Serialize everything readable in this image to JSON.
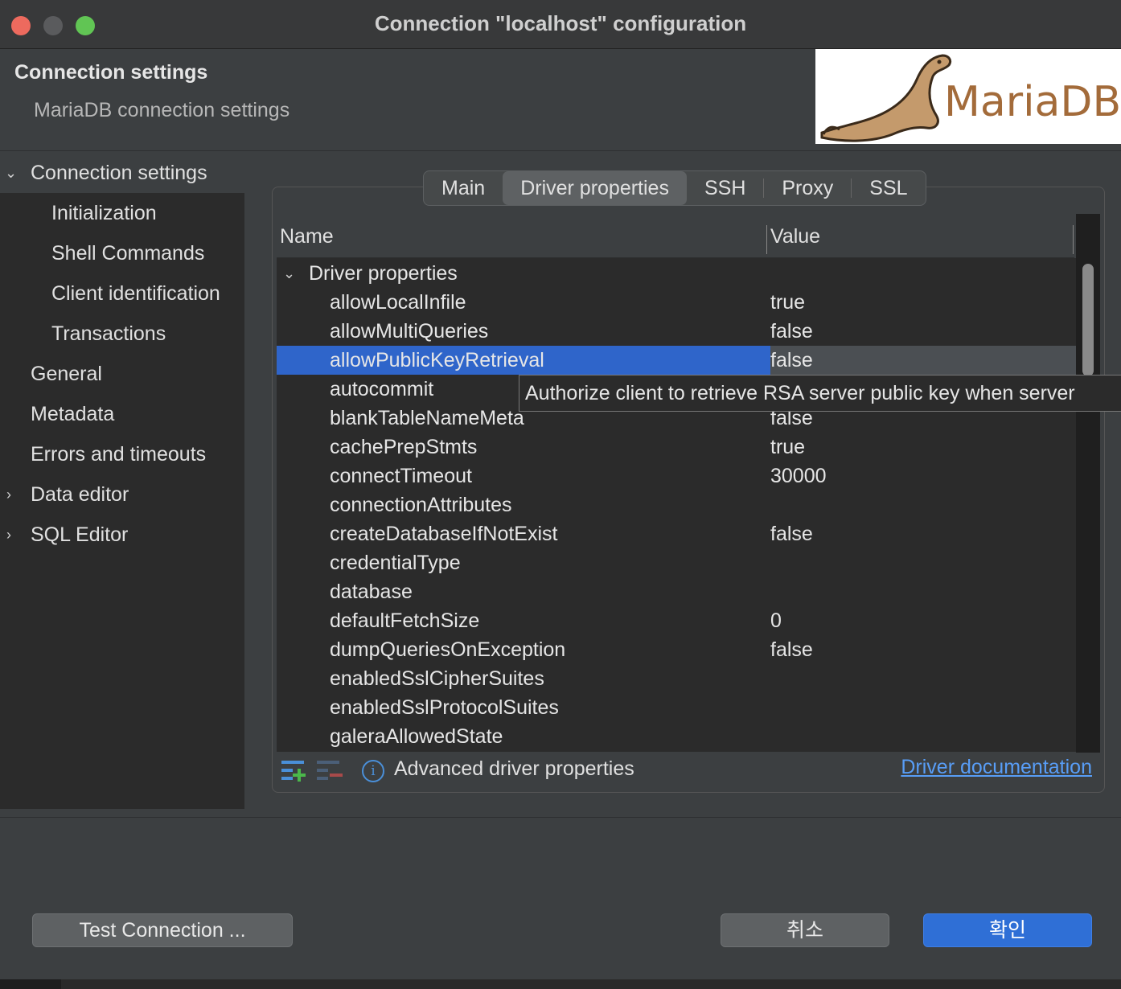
{
  "window": {
    "title": "Connection \"localhost\" configuration"
  },
  "header": {
    "title": "Connection settings",
    "subtitle": "MariaDB connection settings",
    "logo_text": "MariaDB"
  },
  "sidebar": {
    "items": [
      {
        "label": "Connection settings",
        "arrow": "chevron-down"
      },
      {
        "label": "Initialization"
      },
      {
        "label": "Shell Commands"
      },
      {
        "label": "Client identification"
      },
      {
        "label": "Transactions"
      },
      {
        "label": "General"
      },
      {
        "label": "Metadata"
      },
      {
        "label": "Errors and timeouts"
      },
      {
        "label": "Data editor",
        "arrow": "chevron-right"
      },
      {
        "label": "SQL Editor",
        "arrow": "chevron-right"
      }
    ]
  },
  "tabs": [
    {
      "label": "Main"
    },
    {
      "label": "Driver properties",
      "active": true
    },
    {
      "label": "SSH"
    },
    {
      "label": "Proxy"
    },
    {
      "label": "SSL"
    }
  ],
  "table": {
    "col_name": "Name",
    "col_value": "Value",
    "group_label": "Driver properties",
    "rows": [
      {
        "name": "allowLocalInfile",
        "value": "true"
      },
      {
        "name": "allowMultiQueries",
        "value": "false"
      },
      {
        "name": "allowPublicKeyRetrieval",
        "value": "false"
      },
      {
        "name": "autocommit",
        "value": ""
      },
      {
        "name": "blankTableNameMeta",
        "value": "false"
      },
      {
        "name": "cachePrepStmts",
        "value": "true"
      },
      {
        "name": "connectTimeout",
        "value": "30000"
      },
      {
        "name": "connectionAttributes",
        "value": ""
      },
      {
        "name": "createDatabaseIfNotExist",
        "value": "false"
      },
      {
        "name": "credentialType",
        "value": ""
      },
      {
        "name": "database",
        "value": ""
      },
      {
        "name": "defaultFetchSize",
        "value": "0"
      },
      {
        "name": "dumpQueriesOnException",
        "value": "false"
      },
      {
        "name": "enabledSslCipherSuites",
        "value": ""
      },
      {
        "name": "enabledSslProtocolSuites",
        "value": ""
      },
      {
        "name": "galeraAllowedState",
        "value": ""
      }
    ]
  },
  "tooltip": {
    "text": "Authorize client to retrieve RSA server public key when server"
  },
  "footer": {
    "advanced_label": "Advanced driver properties",
    "doc_link": "Driver documentation"
  },
  "buttons": {
    "test": "Test Connection ...",
    "cancel": "취소",
    "ok": "확인"
  },
  "colors": {
    "selection": "#2f65ca",
    "ok_button": "#2f6fd6",
    "link": "#589df6"
  }
}
